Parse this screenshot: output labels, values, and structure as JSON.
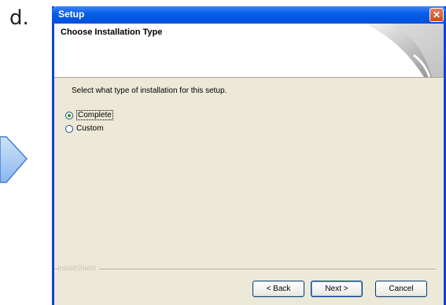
{
  "step_label": "d.",
  "window": {
    "title": "Setup",
    "close_glyph": "✕"
  },
  "header": {
    "title": "Choose Installation Type"
  },
  "instruction": "Select what type of installation for this setup.",
  "options": [
    {
      "label": "Complete",
      "selected": true
    },
    {
      "label": "Custom",
      "selected": false
    }
  ],
  "brand": "InstallShield",
  "buttons": {
    "back": "< Back",
    "next": "Next >",
    "cancel": "Cancel"
  },
  "colors": {
    "titlebar": "#0a5fe9",
    "dialog_bg": "#ece9d8",
    "arrow": "#7fb0ea"
  },
  "icons": [
    "arrow-shape",
    "close-icon",
    "header-swoosh-graphic",
    "radio-icon"
  ]
}
